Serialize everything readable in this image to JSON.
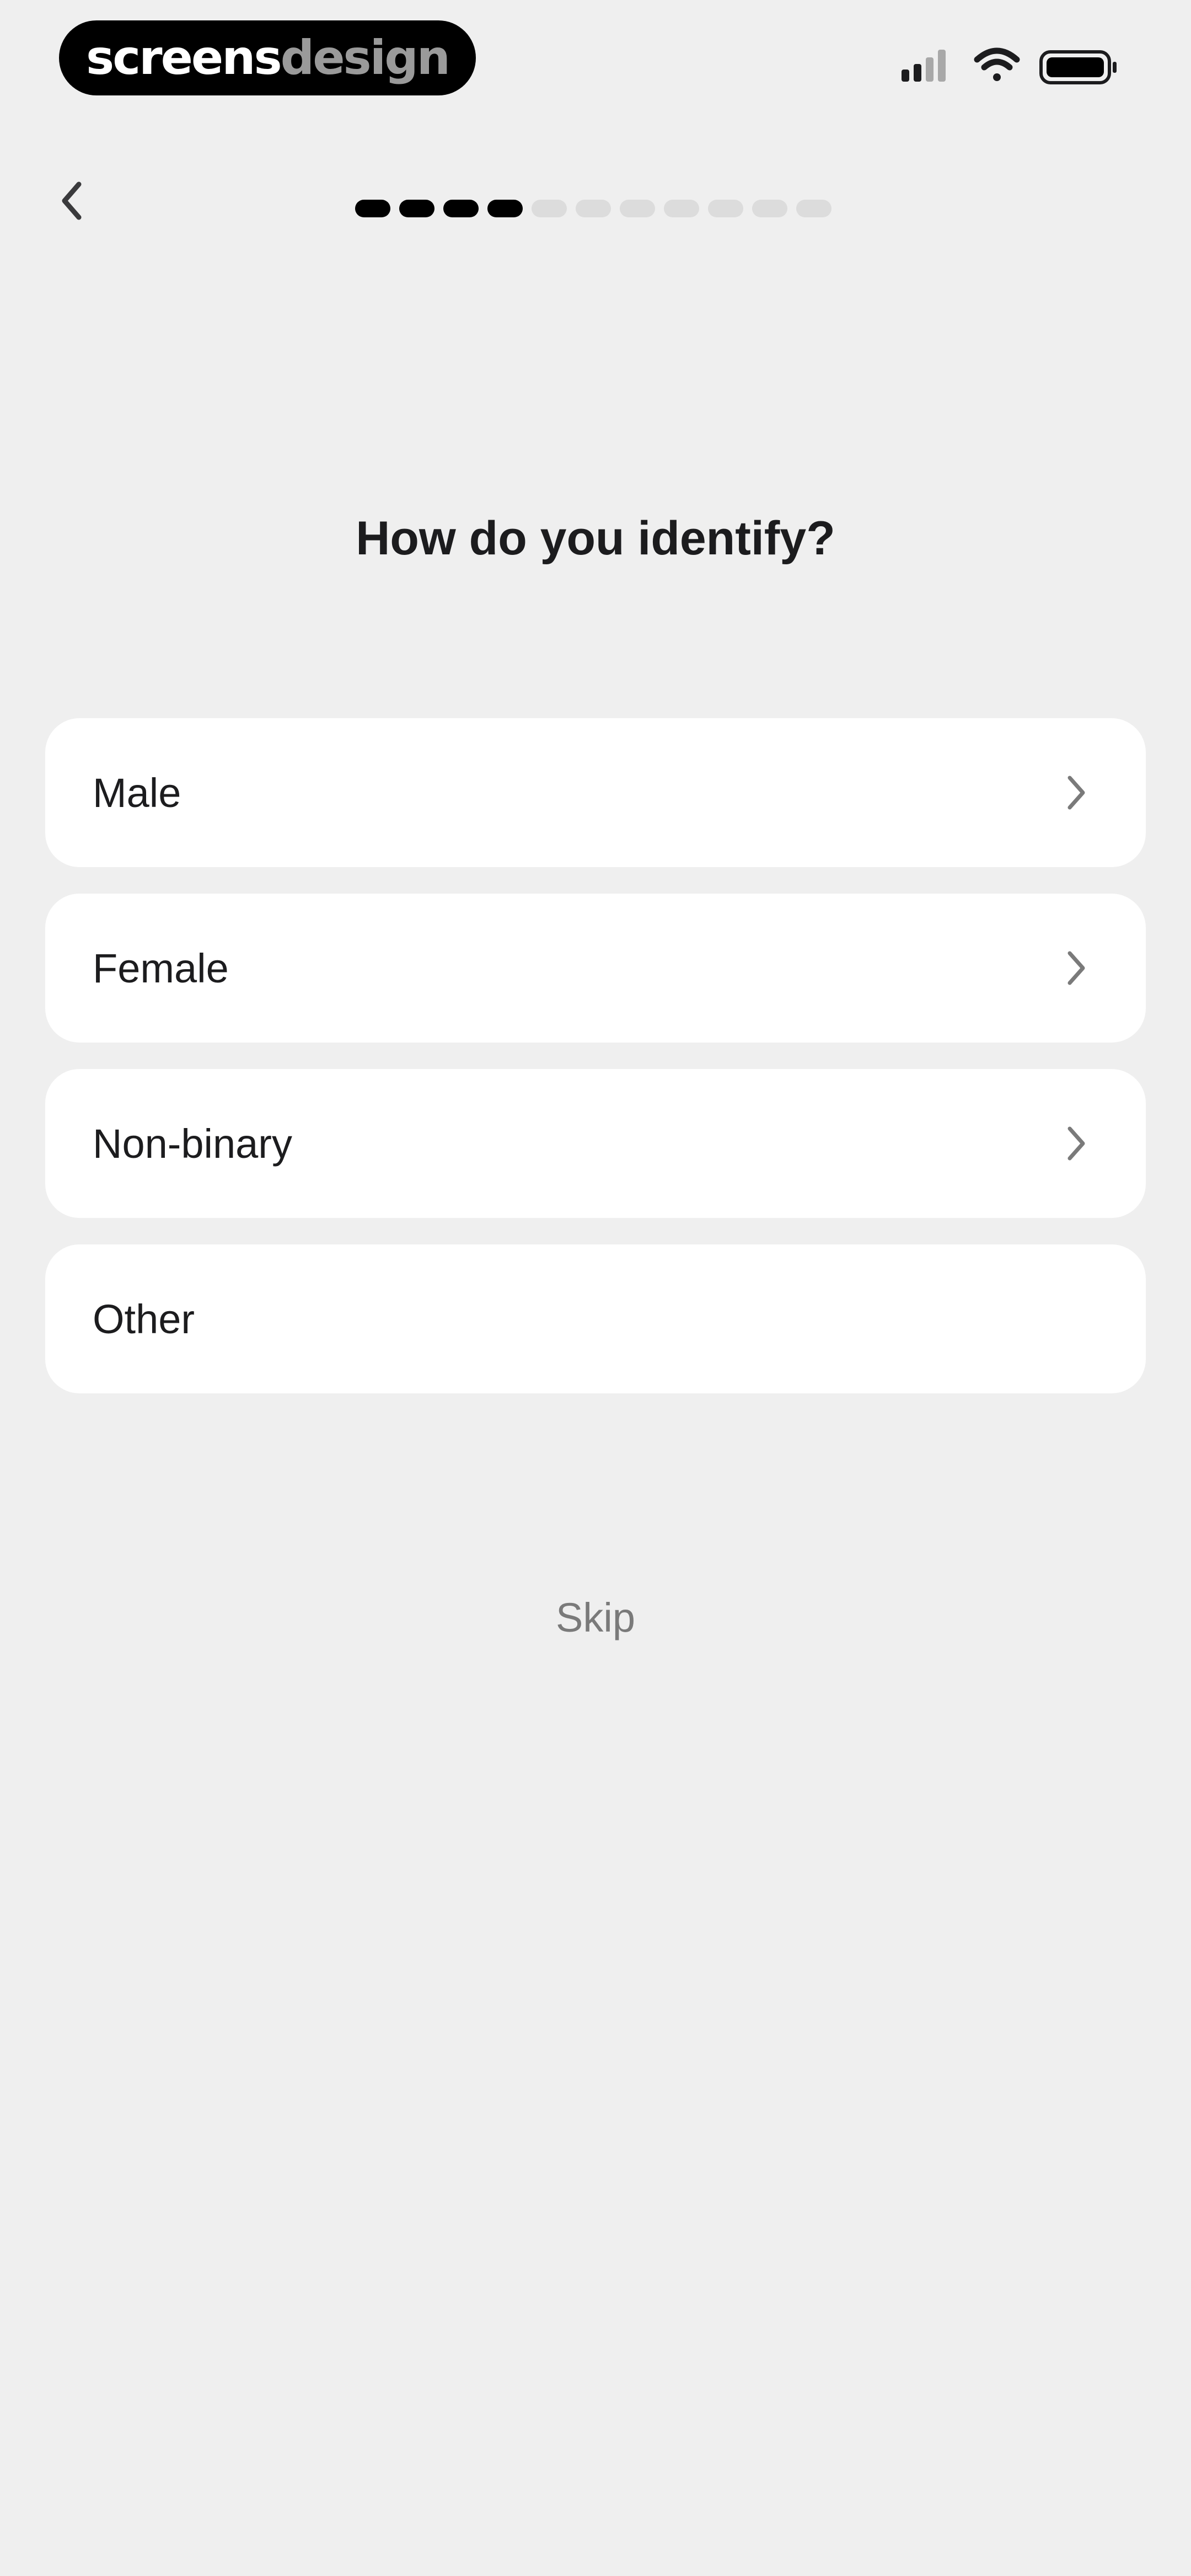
{
  "watermark": {
    "part1": "screens",
    "part2": "design"
  },
  "status_bar": {
    "icons": [
      "cellular-signal-icon",
      "wifi-icon",
      "battery-icon"
    ]
  },
  "nav": {
    "back_icon": "chevron-left-icon",
    "progress": {
      "total_steps": 11,
      "completed_steps": 4
    }
  },
  "title": "How do you identify?",
  "options": [
    {
      "label": "Male",
      "has_chevron": true
    },
    {
      "label": "Female",
      "has_chevron": true
    },
    {
      "label": "Non-binary",
      "has_chevron": true
    },
    {
      "label": "Other",
      "has_chevron": false
    }
  ],
  "skip_label": "Skip",
  "colors": {
    "background": "#efefef",
    "card": "#ffffff",
    "text_primary": "#1c1c1e",
    "text_muted": "#7a7a7a",
    "progress_active": "#000000",
    "progress_inactive": "#dcdcdc"
  }
}
